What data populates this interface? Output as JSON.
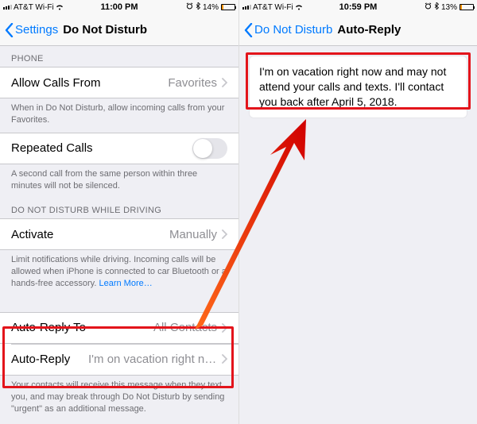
{
  "left": {
    "status": {
      "carrier": "AT&T Wi-Fi",
      "time": "11:00 PM",
      "battery": "14%"
    },
    "nav": {
      "back": "Settings",
      "title": "Do Not Disturb"
    },
    "section_phone": "PHONE",
    "allow_calls": {
      "label": "Allow Calls From",
      "value": "Favorites"
    },
    "allow_calls_foot": "When in Do Not Disturb, allow incoming calls from your Favorites.",
    "repeated": {
      "label": "Repeated Calls"
    },
    "repeated_foot": "A second call from the same person within three minutes will not be silenced.",
    "section_driving": "DO NOT DISTURB WHILE DRIVING",
    "activate": {
      "label": "Activate",
      "value": "Manually"
    },
    "activate_foot": "Limit notifications while driving. Incoming calls will be allowed when iPhone is connected to car Bluetooth or a hands-free accessory. ",
    "learn_more": "Learn More…",
    "autoreply_to": {
      "label": "Auto-Reply To",
      "value": "All Contacts"
    },
    "autoreply": {
      "label": "Auto-Reply",
      "value": "I'm on vacation right now an…"
    },
    "autoreply_foot": "Your contacts will receive this message when they text you, and may break through Do Not Disturb by sending \"urgent\" as an additional message."
  },
  "right": {
    "status": {
      "carrier": "AT&T Wi-Fi",
      "time": "10:59 PM",
      "battery": "13%"
    },
    "nav": {
      "back": "Do Not Disturb",
      "title": "Auto-Reply"
    },
    "message": "I'm on vacation right now and may not attend your calls and texts. I'll contact you back after April 5, 2018."
  }
}
